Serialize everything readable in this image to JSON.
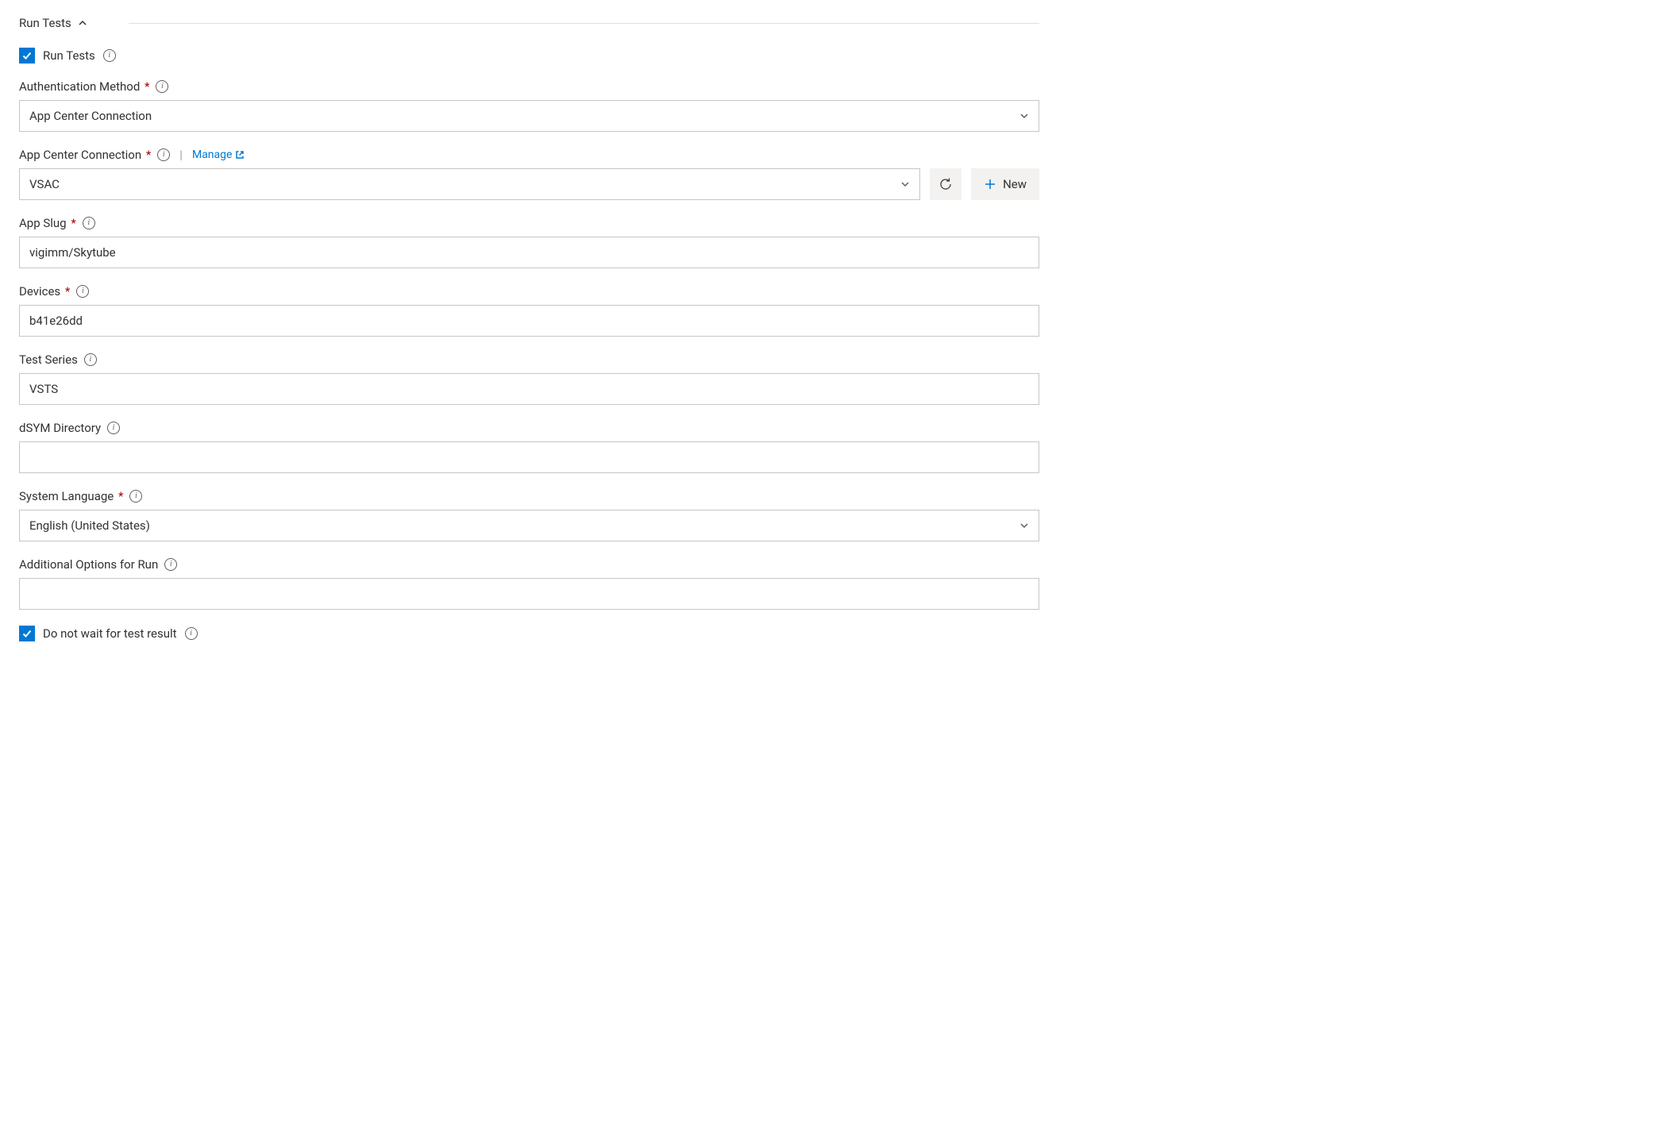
{
  "section": {
    "title": "Run Tests"
  },
  "fields": {
    "runTests": {
      "label": "Run Tests",
      "checked": true
    },
    "authMethod": {
      "label": "Authentication Method",
      "required": true,
      "value": "App Center Connection"
    },
    "appCenterConnection": {
      "label": "App Center Connection",
      "required": true,
      "manageLabel": "Manage",
      "value": "VSAC",
      "newLabel": "New"
    },
    "appSlug": {
      "label": "App Slug",
      "required": true,
      "value": "vigimm/Skytube"
    },
    "devices": {
      "label": "Devices",
      "required": true,
      "value": "b41e26dd"
    },
    "testSeries": {
      "label": "Test Series",
      "required": false,
      "value": "VSTS"
    },
    "dsymDirectory": {
      "label": "dSYM Directory",
      "required": false,
      "value": ""
    },
    "systemLanguage": {
      "label": "System Language",
      "required": true,
      "value": "English (United States)"
    },
    "additionalOptions": {
      "label": "Additional Options for Run",
      "required": false,
      "value": ""
    },
    "doNotWait": {
      "label": "Do not wait for test result",
      "checked": true
    }
  }
}
